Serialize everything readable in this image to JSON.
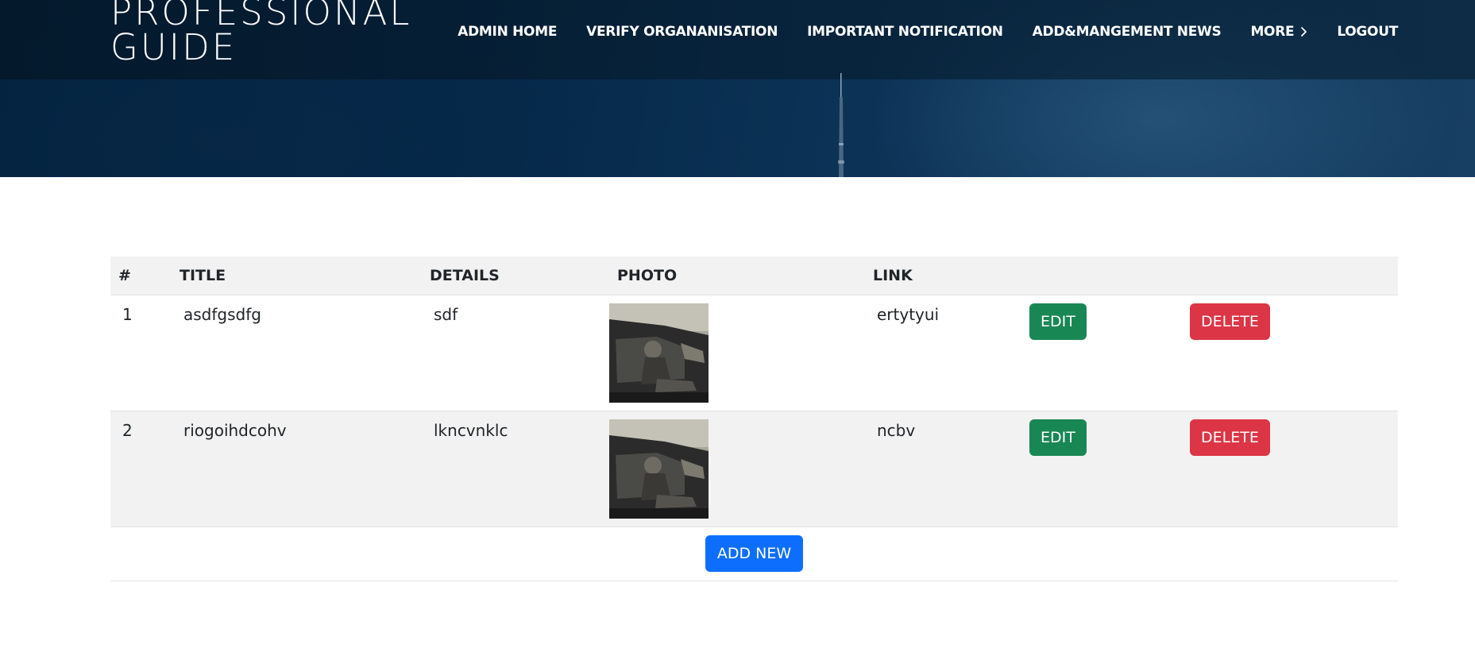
{
  "brand": {
    "title": "PROFESSIONAL\nGUIDE"
  },
  "nav": {
    "items": [
      {
        "label": "ADMIN HOME"
      },
      {
        "label": "VERIFY ORGANANISATION"
      },
      {
        "label": "IMPORTANT NOTIFICATION"
      },
      {
        "label": "ADD&MANGEMENT NEWS"
      },
      {
        "label": "MORE",
        "icon": "chevron-right-icon"
      },
      {
        "label": "LOGOUT"
      }
    ]
  },
  "table": {
    "headers": [
      "#",
      "TITLE",
      "DETAILS",
      "PHOTO",
      "LINK",
      "",
      ""
    ],
    "rows": [
      {
        "num": "1",
        "title": "asdfgsdfg",
        "details": "sdf",
        "link": "ertytyui",
        "edit": "EDIT",
        "delete": "DELETE"
      },
      {
        "num": "2",
        "title": "riogoihdcohv",
        "details": "lkncvnklc",
        "link": "ncbv",
        "edit": "EDIT",
        "delete": "DELETE"
      }
    ],
    "add_label": "ADD NEW"
  },
  "colors": {
    "edit": "#198754",
    "delete": "#dc3545",
    "add": "#0d6efd",
    "header_bg": "#0a2a47"
  }
}
